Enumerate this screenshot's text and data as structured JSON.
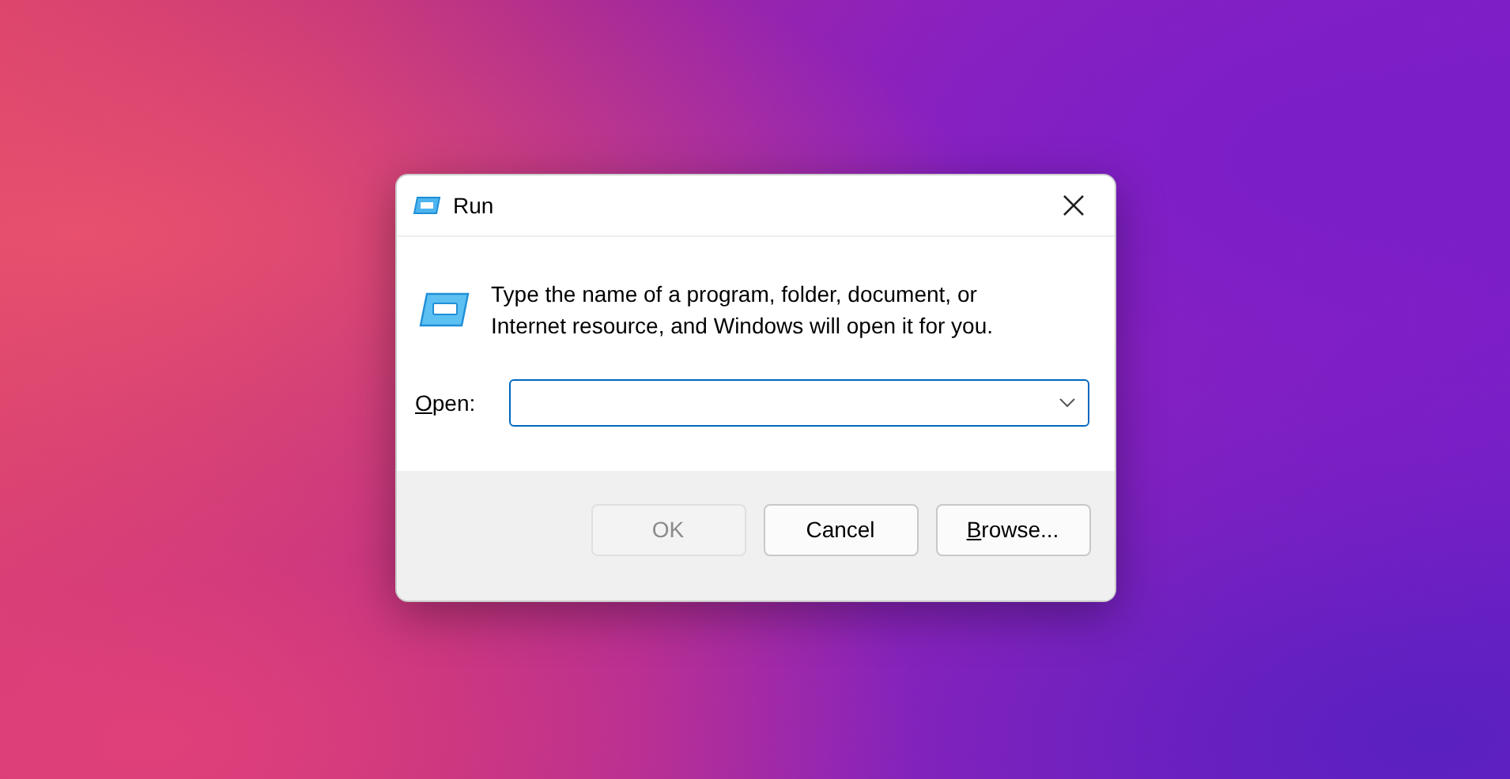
{
  "window": {
    "title": "Run"
  },
  "description": "Type the name of a program, folder, document, or Internet resource, and Windows will open it for you.",
  "open_field": {
    "label": "Open:",
    "label_mnemonic": true
  },
  "buttons": [
    {
      "label": "OK",
      "disabled": true,
      "mnemonic": false
    },
    {
      "label": "Cancel",
      "disabled": false,
      "mnemonic": false
    },
    {
      "label": "Browse...",
      "disabled": false,
      "mnemonic": true
    }
  ]
}
